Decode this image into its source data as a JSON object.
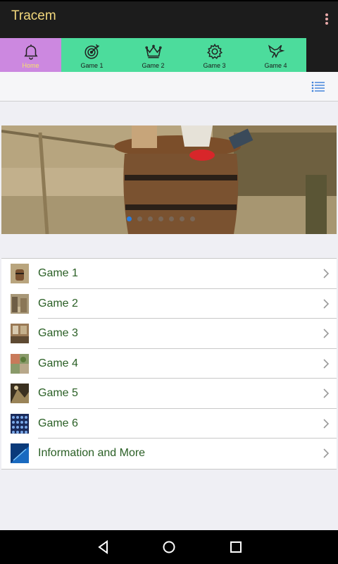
{
  "app": {
    "title": "Tracem"
  },
  "tabs": [
    {
      "label": "Home",
      "icon": "bell-icon",
      "active": true
    },
    {
      "label": "Game 1",
      "icon": "target-icon",
      "active": false
    },
    {
      "label": "Game 2",
      "icon": "crown-icon",
      "active": false
    },
    {
      "label": "Game 3",
      "icon": "gear-icon",
      "active": false
    },
    {
      "label": "Game 4",
      "icon": "bird-icon",
      "active": false
    }
  ],
  "banner": {
    "slide_count": 7,
    "active_slide": 0
  },
  "list": {
    "items": [
      {
        "label": "Game 1",
        "icon": "barrel-thumbnail"
      },
      {
        "label": "Game 2",
        "icon": "ruins-thumbnail"
      },
      {
        "label": "Game 3",
        "icon": "room-thumbnail"
      },
      {
        "label": "Game 4",
        "icon": "leaves-thumbnail"
      },
      {
        "label": "Game 5",
        "icon": "cave-thumbnail"
      },
      {
        "label": "Game 6",
        "icon": "pattern-thumbnail"
      },
      {
        "label": "Information and More",
        "icon": "info-thumbnail"
      }
    ]
  },
  "colors": {
    "appbar": "#1c1c1c",
    "title": "#f2d77c",
    "tab_bg": "#4cdc9c",
    "tab_active_bg": "#cc88e0",
    "tab_active_label": "#f6e26b",
    "list_text": "#2a5f25",
    "accent": "#2b7fe0"
  }
}
